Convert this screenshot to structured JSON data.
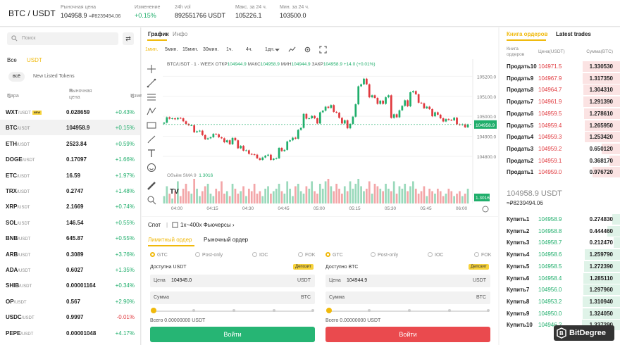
{
  "ticker": {
    "pair": "BTC / USDT",
    "items": [
      {
        "label": "Рыночная цена",
        "value": "104958.9",
        "sub": "≈₽8239494.06"
      },
      {
        "label": "Изменение",
        "value": "+0.15%"
      },
      {
        "label": "24h vol",
        "value": "892551766 USDT"
      },
      {
        "label": "Макс. за 24 ч.",
        "value": "105226.1"
      },
      {
        "label": "Мин. за 24 ч.",
        "value": "103500.0"
      }
    ]
  },
  "markets": {
    "search_placeholder": "Поиск",
    "tabs": [
      "Все",
      "USDT"
    ],
    "subtabs": [
      "всё",
      "New Listed Tokens"
    ],
    "headers": [
      "Пара",
      "Рыночная цена",
      "Изменение"
    ],
    "new_badge": "NEW",
    "rows": [
      {
        "base": "WXT",
        "quote": "/USDT",
        "price": "0.028659",
        "change": "+0.43%",
        "dir": "up",
        "new": true
      },
      {
        "base": "BTC",
        "quote": "/USDT",
        "price": "104958.9",
        "change": "+0.15%",
        "dir": "up",
        "selected": true
      },
      {
        "base": "ETH",
        "quote": "/USDT",
        "price": "2523.84",
        "change": "+0.59%",
        "dir": "up"
      },
      {
        "base": "DOGE",
        "quote": "/USDT",
        "price": "0.17097",
        "change": "+1.66%",
        "dir": "up"
      },
      {
        "base": "ETC",
        "quote": "/USDT",
        "price": "16.59",
        "change": "+1.97%",
        "dir": "up"
      },
      {
        "base": "TRX",
        "quote": "/USDT",
        "price": "0.2747",
        "change": "+1.48%",
        "dir": "up"
      },
      {
        "base": "XRP",
        "quote": "/USDT",
        "price": "2.1669",
        "change": "+0.74%",
        "dir": "up"
      },
      {
        "base": "SOL",
        "quote": "/USDT",
        "price": "146.54",
        "change": "+0.55%",
        "dir": "up"
      },
      {
        "base": "BNB",
        "quote": "/USDT",
        "price": "645.87",
        "change": "+0.55%",
        "dir": "up"
      },
      {
        "base": "ARB",
        "quote": "/USDT",
        "price": "0.3089",
        "change": "+3.76%",
        "dir": "up"
      },
      {
        "base": "ADA",
        "quote": "/USDT",
        "price": "0.6027",
        "change": "+1.35%",
        "dir": "up"
      },
      {
        "base": "SHIB",
        "quote": "/USDT",
        "price": "0.00001164",
        "change": "+0.34%",
        "dir": "up"
      },
      {
        "base": "OP",
        "quote": "/USDT",
        "price": "0.567",
        "change": "+2.90%",
        "dir": "up"
      },
      {
        "base": "USDC",
        "quote": "/USDT",
        "price": "0.9997",
        "change": "-0.01%",
        "dir": "down"
      },
      {
        "base": "PEPE",
        "quote": "/USDT",
        "price": "0.00001048",
        "change": "+4.17%",
        "dir": "up"
      }
    ]
  },
  "chart_panel": {
    "tabs": [
      "График",
      "Инфо"
    ],
    "timeframes": [
      "1мин.",
      "5мин.",
      "15мин.",
      "30мин.",
      "1ч.",
      "4ч.",
      "1дн."
    ],
    "active_timeframe": "1мин.",
    "ohlc": {
      "title": "BTC/USDT · 1 · WEEX",
      "o_label": "ОТКР",
      "o": "104944.9",
      "h_label": "МАКС",
      "h": "104958.9",
      "l_label": "МИН",
      "l": "104944.9",
      "c_label": "ЗАКР",
      "c": "104958.9",
      "delta": "+14.0 (+0.01%)"
    },
    "volume": {
      "label": "Объём SMA 9",
      "value": "1.3016",
      "last": "1.3016"
    },
    "last_price_tag": "104958.9"
  },
  "chart_data": {
    "type": "candlestick",
    "title": "BTC/USDT · 1 · WEEX",
    "x_ticks": [
      "04:00",
      "04:15",
      "04:30",
      "04:45",
      "05:00",
      "05:15",
      "05:30",
      "05:45",
      "06:00"
    ],
    "y_ticks": [
      105200,
      105100,
      105000,
      104900,
      104800
    ],
    "ylim": [
      104740,
      105240
    ],
    "last_price": 104958.9,
    "close_path": [
      104968,
      104995,
      104988,
      104990,
      104985,
      104992,
      104990,
      104975,
      104962,
      104955,
      104955,
      104920,
      104925,
      104928,
      104906,
      104885,
      104890,
      104895,
      104912,
      104910,
      104895,
      104890,
      104870,
      104880,
      104860,
      104892,
      104880,
      104840,
      104852,
      104828,
      104830,
      104812,
      104810,
      104808,
      104790,
      104782,
      104794,
      104803,
      104808,
      104782,
      104788,
      104790,
      104842,
      104826,
      104832,
      104874,
      104880,
      104893,
      104888,
      104932,
      104942,
      105012,
      104988,
      104990,
      105002,
      104990,
      104964,
      105020,
      105028,
      105048,
      105042,
      105056,
      105022,
      105018,
      104992,
      104964,
      104980,
      104940,
      104962,
      104998,
      105060,
      105150,
      105160,
      105188,
      105160,
      105095,
      105105,
      105092,
      105062,
      105078,
      105062,
      105095,
      105105,
      104992,
      105010,
      104995,
      105030,
      105052,
      105080,
      105050,
      105120,
      105126,
      105110,
      105068,
      105065,
      105040,
      105048,
      105036,
      105000,
      105020,
      105008,
      104990,
      104974,
      104986,
      104982,
      104980,
      104993,
      104960,
      104957,
      104960,
      104945,
      104959
    ],
    "volumes": [
      0.3,
      0.7,
      0.4,
      0.2,
      0.5,
      0.9,
      0.3,
      0.6,
      0.8,
      0.5,
      0.4,
      1.0,
      0.6,
      0.3,
      0.5,
      0.7,
      0.8,
      0.4,
      0.3,
      0.6,
      0.5,
      0.9,
      0.4,
      0.5,
      0.3,
      0.8,
      0.6,
      0.4,
      0.5,
      0.7,
      0.3,
      0.6,
      0.5,
      0.8,
      0.4,
      0.5,
      0.3,
      0.6,
      0.7,
      0.4,
      0.5,
      0.6,
      0.8,
      0.5,
      0.4,
      0.9,
      0.6,
      0.3,
      0.7,
      0.8,
      0.5,
      0.4,
      0.7,
      0.6,
      0.9,
      0.5,
      0.4,
      0.8,
      0.6,
      0.9,
      1.0,
      0.7,
      0.5,
      0.8,
      0.6,
      0.4,
      0.7,
      0.5,
      0.9,
      0.6,
      0.8,
      1.0,
      0.7,
      0.5,
      0.6,
      0.9,
      0.4,
      0.8,
      0.7,
      0.6,
      0.5,
      0.8,
      0.6,
      0.5,
      0.9,
      0.4,
      0.7,
      0.6,
      0.8,
      0.5,
      0.7,
      0.9,
      0.6,
      0.4,
      0.5,
      0.7,
      0.3,
      0.6,
      0.5,
      0.4,
      0.6,
      0.5,
      0.3,
      0.4,
      0.6,
      0.5,
      0.3,
      0.4,
      0.5,
      0.3,
      0.4,
      0.6
    ]
  },
  "order_form": {
    "spot": "Спот",
    "futures": "1x~400x Фьючерсы",
    "tabs": [
      "Лимитный ордер",
      "Рыночный ордер"
    ],
    "tif": [
      "GTC",
      "Post-only",
      "IOC",
      "FOK"
    ],
    "buy": {
      "available": "Доступна USDT",
      "deposit": "Депозит",
      "price_label": "Цена",
      "price": "104945.0",
      "price_unit": "USDT",
      "qty_label": "Сумма",
      "qty_unit": "BTC",
      "total": "Всего 0.00000000 USDT",
      "button": "Войти"
    },
    "sell": {
      "available": "Доступно BTC",
      "deposit": "Депозит",
      "price_label": "Цена",
      "price": "104944.9",
      "price_unit": "USDT",
      "qty_label": "Сумма",
      "qty_unit": "BTC",
      "total": "Всего 0.00000000 USDT",
      "button": "Войти"
    }
  },
  "orderbook": {
    "tabs": [
      "Книга ордеров",
      "Latest trades"
    ],
    "headers": [
      "Книга ордеров",
      "Цена(USDT)",
      "Сумма(BTC)"
    ],
    "asks": [
      {
        "name": "Продать10",
        "price": "104971.5",
        "amount": "1.330530",
        "depth": 0.95
      },
      {
        "name": "Продать9",
        "price": "104967.9",
        "amount": "1.317350",
        "depth": 0.94
      },
      {
        "name": "Продать8",
        "price": "104964.7",
        "amount": "1.304310",
        "depth": 0.93
      },
      {
        "name": "Продать7",
        "price": "104961.9",
        "amount": "1.291390",
        "depth": 0.92
      },
      {
        "name": "Продать6",
        "price": "104959.5",
        "amount": "1.278610",
        "depth": 0.91
      },
      {
        "name": "Продать5",
        "price": "104959.4",
        "amount": "1.265950",
        "depth": 0.9
      },
      {
        "name": "Продать4",
        "price": "104959.3",
        "amount": "1.253420",
        "depth": 0.89
      },
      {
        "name": "Продать3",
        "price": "104959.2",
        "amount": "0.650120",
        "depth": 0.46
      },
      {
        "name": "Продать2",
        "price": "104959.1",
        "amount": "0.368170",
        "depth": 0.26
      },
      {
        "name": "Продать1",
        "price": "104959.0",
        "amount": "0.976720",
        "depth": 0.7
      }
    ],
    "mid_price": "104958.9 USDT",
    "mid_rub": "≈₽8239494.06",
    "bids": [
      {
        "name": "Купить1",
        "price": "104958.9",
        "amount": "0.274830",
        "depth": 0.2
      },
      {
        "name": "Купить2",
        "price": "104958.8",
        "amount": "0.444460",
        "depth": 0.32
      },
      {
        "name": "Купить3",
        "price": "104958.7",
        "amount": "0.212470",
        "depth": 0.16
      },
      {
        "name": "Купить4",
        "price": "104958.6",
        "amount": "1.259790",
        "depth": 0.9
      },
      {
        "name": "Купить5",
        "price": "104958.5",
        "amount": "1.272390",
        "depth": 0.91
      },
      {
        "name": "Купить6",
        "price": "104958.4",
        "amount": "1.285110",
        "depth": 0.92
      },
      {
        "name": "Купить7",
        "price": "104956.0",
        "amount": "1.297960",
        "depth": 0.93
      },
      {
        "name": "Купить8",
        "price": "104953.2",
        "amount": "1.310940",
        "depth": 0.94
      },
      {
        "name": "Купить9",
        "price": "104950.0",
        "amount": "1.324050",
        "depth": 0.95
      },
      {
        "name": "Купить10",
        "price": "104946.2",
        "amount": "1.337290",
        "depth": 0.96
      }
    ]
  },
  "watermark": "BitDegree",
  "colors": {
    "up": "#1fae6b",
    "down": "#e0393e",
    "accent": "#f0b90b",
    "buy_btn": "#26b574",
    "sell_btn": "#ea4a4e"
  }
}
